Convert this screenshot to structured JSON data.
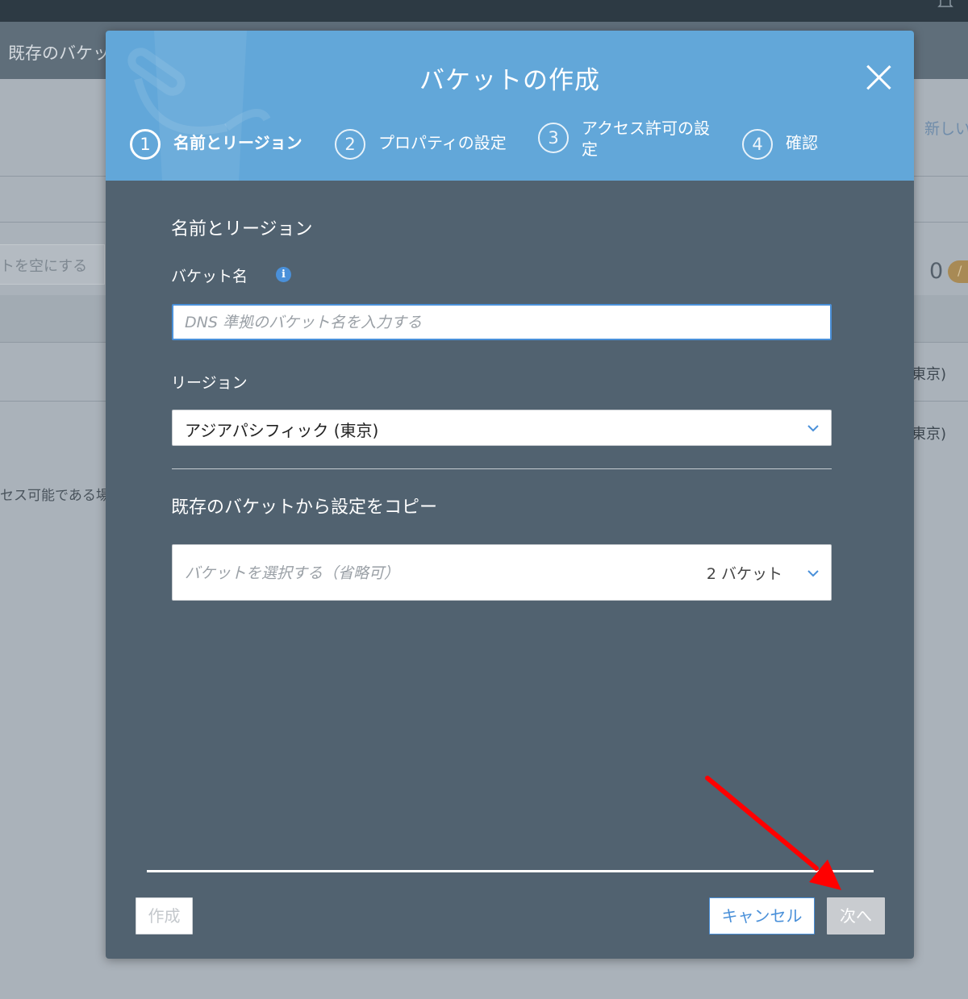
{
  "background": {
    "page_title": "既存のバケッ",
    "empty_button": "トを空にする",
    "new_link": "新しい",
    "count": "0",
    "count_badge": "/",
    "region_cell_1": "東京)",
    "region_cell_2": "東京)",
    "access_text": "セス可能である場"
  },
  "modal": {
    "title": "バケットの作成",
    "steps": [
      {
        "num": "1",
        "label": "名前とリージョン",
        "active": true
      },
      {
        "num": "2",
        "label": "プロパティの設定",
        "active": false
      },
      {
        "num": "3",
        "label": "アクセス許可の設定",
        "active": false
      },
      {
        "num": "4",
        "label": "確認",
        "active": false
      }
    ],
    "section_title": "名前とリージョン",
    "bucket_name": {
      "label": "バケット名",
      "info_icon": "i",
      "value": "",
      "placeholder": "DNS 準拠のバケット名を入力する"
    },
    "region": {
      "label": "リージョン",
      "selected": "アジアパシフィック (東京)"
    },
    "copy_section": {
      "title": "既存のバケットから設定をコピー",
      "placeholder": "バケットを選択する（省略可）",
      "count": "2 バケット"
    },
    "buttons": {
      "create": "作成",
      "cancel": "キャンセル",
      "next": "次へ"
    }
  },
  "colors": {
    "header_blue": "#62a7d9",
    "body_slate": "#516270",
    "accent": "#4a90d9",
    "annotation_arrow": "#ff0000"
  },
  "icons": {
    "close": "close-icon",
    "info": "info-icon",
    "chevron": "chevron-down-icon",
    "bell": "bell-icon"
  }
}
